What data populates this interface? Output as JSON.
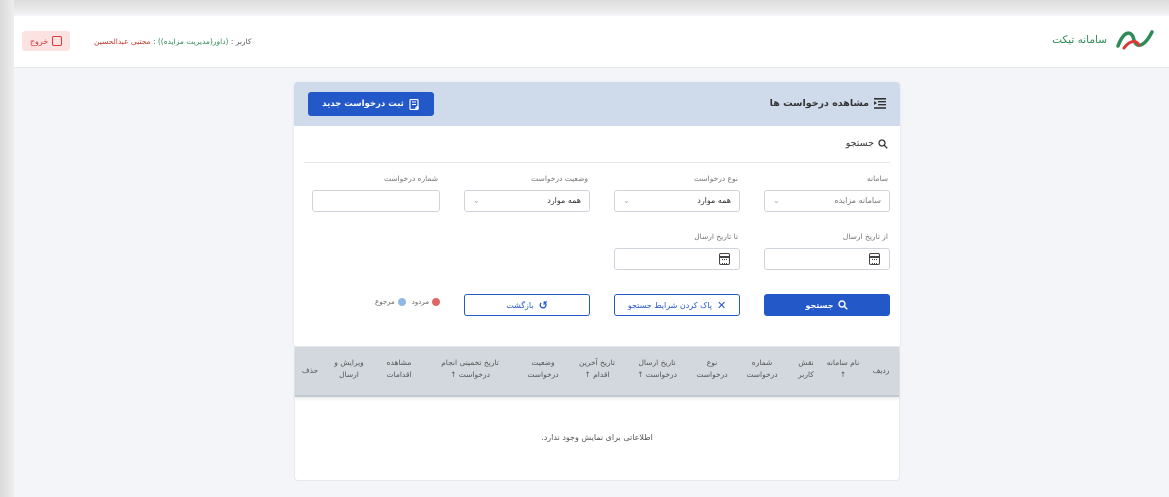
{
  "header": {
    "system_title": "سامانه تیکت",
    "user_prefix": "کاربر :",
    "user_role": "(داور(مدیریت مزایده))",
    "user_sep": " : ",
    "user_name": "مجتبی عبدالحسین",
    "logout_label": "خروج"
  },
  "card": {
    "title": "مشاهده درخواست ها",
    "new_request_label": "ثبت درخواست جدید",
    "search_heading": "جستجو"
  },
  "filters": {
    "system_label": "سامانه",
    "system_value": "سامانه مزایده",
    "request_type_label": "نوع درخواست",
    "request_type_value": "همه موارد",
    "request_status_label": "وضعیت درخواست",
    "request_status_value": "همه موارد",
    "request_number_label": "شماره درخواست",
    "from_date_label": "از تاریخ ارسال",
    "to_date_label": "تا تاریخ ارسال"
  },
  "actions": {
    "search_label": "جستجو",
    "clear_label": "پاک کردن شرایط جستجو",
    "back_label": "بازگشت"
  },
  "legend": {
    "rejected_label": "مردود",
    "returned_label": "مرجوع",
    "rejected_color": "#e06666",
    "returned_color": "#8fb8e6"
  },
  "table": {
    "columns": [
      "ردیف",
      "نام سامانه ↑",
      "نقش کاربر",
      "شماره درخواست",
      "نوع درخواست",
      "تاریخ ارسال درخواست ↑",
      "تاریخ آخرین اقدام ↑",
      "وضعیت درخواست",
      "تاریخ تخمینی انجام درخواست ↑",
      "مشاهده اقدامات",
      "ویرایش و ارسال",
      "حذف"
    ],
    "empty_message": "اطلاعاتی برای نمایش وجود ندارد."
  },
  "colors": {
    "primary": "#2358c9",
    "header_bg": "#cfdbea",
    "logout_bg": "#fde2e2",
    "accent_green": "#2e8b57"
  }
}
